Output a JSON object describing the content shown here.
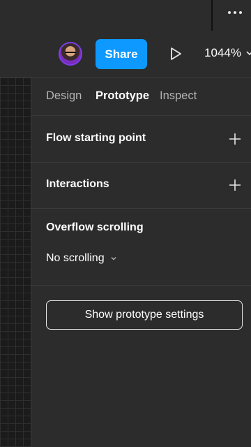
{
  "toolbar": {
    "share_label": "Share",
    "zoom_value": "1044%",
    "share_color": "#0d99ff"
  },
  "panel": {
    "tabs": [
      {
        "label": "Design",
        "active": false
      },
      {
        "label": "Prototype",
        "active": true
      },
      {
        "label": "Inspect",
        "active": false
      }
    ],
    "flow_starting_point": "Flow starting point",
    "interactions": "Interactions",
    "overflow_scrolling": {
      "title": "Overflow scrolling",
      "value": "No scrolling"
    },
    "settings_button_label": "Show prototype settings"
  },
  "icons": [
    "more-icon",
    "avatar",
    "play-icon",
    "chevron-down-icon",
    "plus-icon"
  ]
}
